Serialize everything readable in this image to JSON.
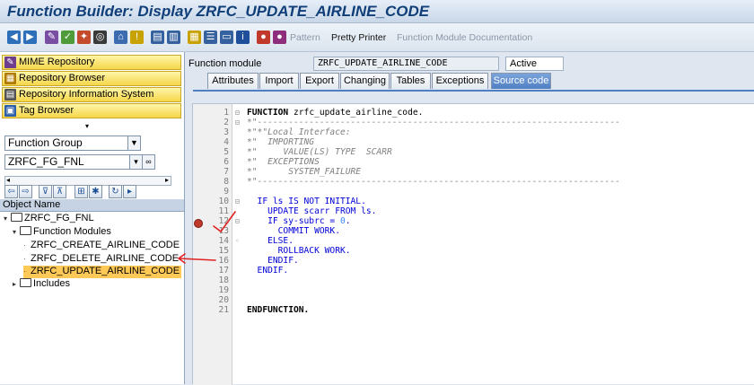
{
  "window": {
    "title": "Function Builder: Display ZRFC_UPDATE_AIRLINE_CODE"
  },
  "toolbar": {
    "pattern_label": "Pattern",
    "pretty_printer_label": "Pretty Printer",
    "fm_doc_label": "Function Module Documentation"
  },
  "navigator": {
    "buttons": [
      {
        "label": "MIME Repository",
        "icon": "mime-icon"
      },
      {
        "label": "Repository Browser",
        "icon": "repository-browser-icon"
      },
      {
        "label": "Repository Information System",
        "icon": "info-system-icon"
      },
      {
        "label": "Tag Browser",
        "icon": "tag-icon"
      }
    ],
    "object_type": "Function Group",
    "object_name": "ZRFC_FG_FNL",
    "tree_header": "Object Name",
    "tree": {
      "root": "ZRFC_FG_FNL",
      "function_modules_label": "Function Modules",
      "function_modules": [
        "ZRFC_CREATE_AIRLINE_CODE",
        "ZRFC_DELETE_AIRLINE_CODE",
        "ZRFC_UPDATE_AIRLINE_CODE"
      ],
      "includes_label": "Includes"
    }
  },
  "header": {
    "field_label": "Function module",
    "field_value": "ZRFC_UPDATE_AIRLINE_CODE",
    "status": "Active"
  },
  "tabs": [
    "Attributes",
    "Import",
    "Export",
    "Changing",
    "Tables",
    "Exceptions",
    "Source code"
  ],
  "active_tab": "Source code",
  "code": [
    {
      "n": "1",
      "fold": "⊟",
      "parts": [
        {
          "t": "FUNCTION",
          "c": "kwb"
        },
        {
          "t": " zrfc_update_airline_code.",
          "c": "plain"
        }
      ]
    },
    {
      "n": "2",
      "fold": "⊟",
      "parts": [
        {
          "t": "*\"----------------------------------------------------------------------",
          "c": "cm"
        }
      ]
    },
    {
      "n": "3",
      "fold": "",
      "parts": [
        {
          "t": "*\"*\"Local Interface:",
          "c": "cm"
        }
      ]
    },
    {
      "n": "4",
      "fold": "",
      "parts": [
        {
          "t": "*\"  IMPORTING",
          "c": "cm"
        }
      ]
    },
    {
      "n": "5",
      "fold": "",
      "parts": [
        {
          "t": "*\"     VALUE(LS) TYPE  SCARR",
          "c": "cm"
        }
      ]
    },
    {
      "n": "6",
      "fold": "",
      "parts": [
        {
          "t": "*\"  EXCEPTIONS",
          "c": "cm"
        }
      ]
    },
    {
      "n": "7",
      "fold": "",
      "parts": [
        {
          "t": "*\"      SYSTEM_FAILURE",
          "c": "cm"
        }
      ]
    },
    {
      "n": "8",
      "fold": "",
      "parts": [
        {
          "t": "*\"----------------------------------------------------------------------",
          "c": "cm"
        }
      ]
    },
    {
      "n": "9",
      "fold": "",
      "parts": []
    },
    {
      "n": "10",
      "fold": "⊟",
      "parts": [
        {
          "t": "  IF ls IS NOT INITIAL.",
          "c": "kw"
        }
      ]
    },
    {
      "n": "11",
      "fold": "",
      "parts": [
        {
          "t": "    UPDATE scarr FROM ls.",
          "c": "kw"
        }
      ]
    },
    {
      "n": "12",
      "fold": "⊟",
      "parts": [
        {
          "t": "    IF sy-subrc = ",
          "c": "kw"
        },
        {
          "t": "0",
          "c": "num"
        },
        {
          "t": ".",
          "c": "kw"
        }
      ]
    },
    {
      "n": "13",
      "fold": "",
      "parts": [
        {
          "t": "      COMMIT WORK.",
          "c": "kw"
        }
      ]
    },
    {
      "n": "14",
      "fold": "◦",
      "parts": [
        {
          "t": "    ELSE.",
          "c": "kw"
        }
      ]
    },
    {
      "n": "15",
      "fold": "",
      "parts": [
        {
          "t": "      ROLLBACK WORK.",
          "c": "kw"
        }
      ]
    },
    {
      "n": "16",
      "fold": "",
      "parts": [
        {
          "t": "    ENDIF.",
          "c": "kw"
        }
      ]
    },
    {
      "n": "17",
      "fold": "",
      "parts": [
        {
          "t": "  ENDIF.",
          "c": "kw"
        }
      ]
    },
    {
      "n": "18",
      "fold": "",
      "parts": []
    },
    {
      "n": "19",
      "fold": "",
      "parts": []
    },
    {
      "n": "20",
      "fold": "",
      "parts": []
    },
    {
      "n": "21",
      "fold": "",
      "parts": [
        {
          "t": "ENDFUNCTION.",
          "c": "kwb"
        }
      ]
    }
  ],
  "colors": {
    "title": "#0f3e78",
    "nav_button": "#f5d64a",
    "selected_node": "#ffc957",
    "active_tab": "#4f7fc3",
    "keyword": "#0000d6",
    "annotation": "#e02020"
  }
}
